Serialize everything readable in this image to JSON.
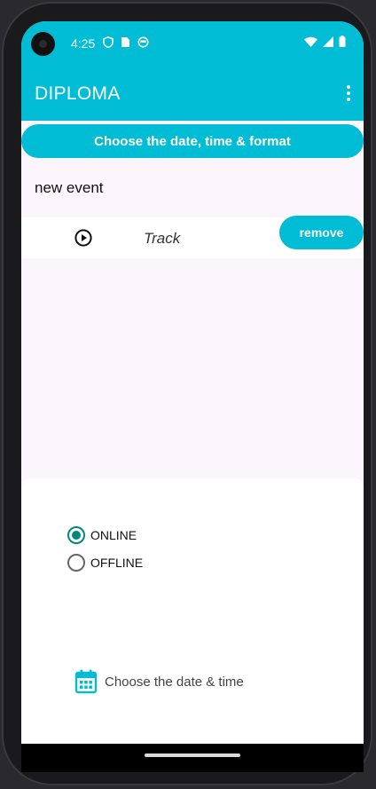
{
  "status_bar": {
    "time": "4:25",
    "background": "#00bcd4",
    "left_icons": [
      "shield-icon",
      "sim-card-icon",
      "face-icon"
    ],
    "right_icons": [
      "wifi-icon",
      "signal-icon",
      "battery-icon"
    ]
  },
  "app_bar": {
    "title": "DIPLOMA",
    "menu_icon": "more-vert-icon"
  },
  "main": {
    "choose_button_label": "Choose the date, time & format",
    "event_name": "new event",
    "track": {
      "icon": "play-circle-icon",
      "label": "Track"
    },
    "remove_label": "remove"
  },
  "bottom_sheet": {
    "format_options": [
      {
        "label": "ONLINE",
        "selected": true
      },
      {
        "label": "OFFLINE",
        "selected": false
      }
    ],
    "date_time": {
      "icon": "calendar-icon",
      "label": "Choose the date & time"
    }
  },
  "colors": {
    "accent": "#00bcd4",
    "radio_selected": "#00897b",
    "background": "#fbf5fc"
  }
}
